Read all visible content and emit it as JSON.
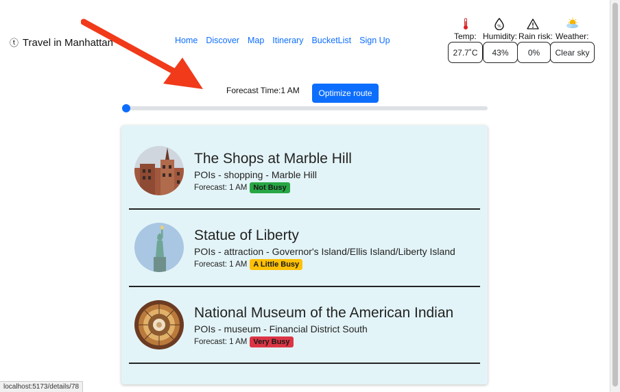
{
  "brand": {
    "logo_icon": "ⓣ",
    "title": "Travel in Manhattan"
  },
  "nav": [
    "Home",
    "Discover",
    "Map",
    "Itinerary",
    "BucketList",
    "Sign Up"
  ],
  "weather": {
    "temp": {
      "icon": "thermometer-icon",
      "label": "Temp:",
      "value": "27.7˚C"
    },
    "humidity": {
      "icon": "water-drop-icon",
      "label": "Humidity:",
      "value": "43%"
    },
    "rain": {
      "icon": "warning-icon",
      "label": "Rain risk:",
      "value": "0%"
    },
    "conditions": {
      "icon": "partly-cloudy-icon",
      "label": "Weather:",
      "value": "Clear sky"
    }
  },
  "forecast": {
    "label": "Forecast Time:1 AM",
    "slider_value": 0
  },
  "optimize_button": "Optimize route",
  "places": [
    {
      "name": "The Shops at Marble Hill",
      "details": "POIs - shopping - Marble Hill",
      "forecast": "Forecast: 1 AM",
      "status": "Not Busy",
      "status_color": "#28a745"
    },
    {
      "name": "Statue of Liberty",
      "details": "POIs - attraction - Governor's Island/Ellis Island/Liberty Island",
      "forecast": "Forecast: 1 AM",
      "status": "A Little Busy",
      "status_color": "#ffc107"
    },
    {
      "name": "National Museum of the American Indian",
      "details": "POIs - museum - Financial District South",
      "forecast": "Forecast: 1 AM",
      "status": "Very Busy",
      "status_color": "#dc3545"
    }
  ],
  "status_url": "localhost:5173/details/78",
  "colors": {
    "accent": "#0d6efd",
    "card_bg": "#e3f4f8",
    "arrow": "#f03a1a"
  }
}
